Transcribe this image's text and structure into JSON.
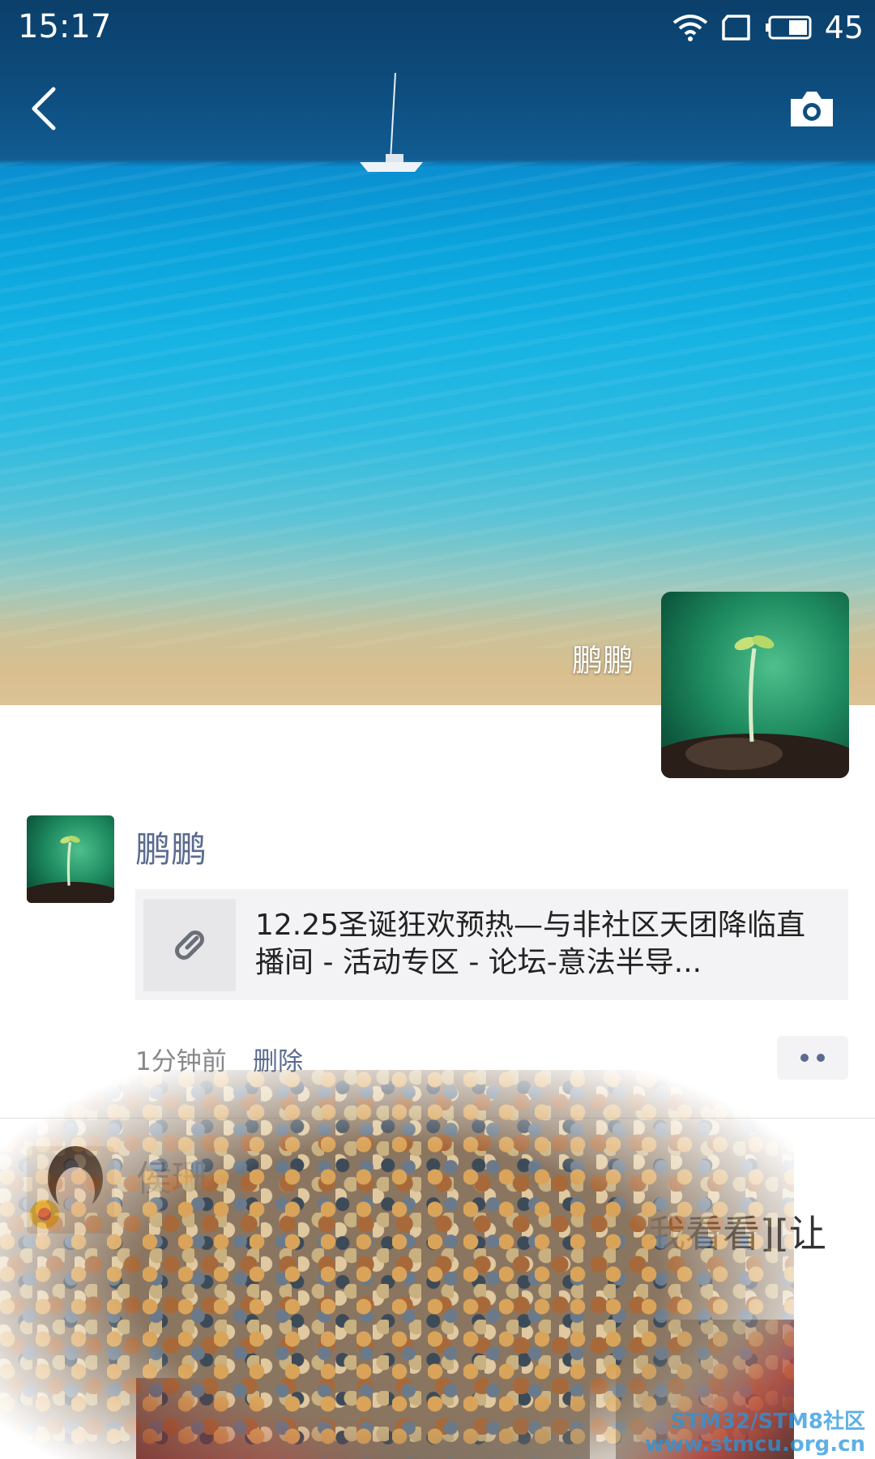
{
  "status_bar": {
    "time": "15:17",
    "battery_percent": "45",
    "icons": [
      "wifi-icon",
      "sim-card-icon",
      "battery-icon"
    ]
  },
  "header": {
    "back_icon": "back-arrow-icon",
    "camera_icon": "camera-icon"
  },
  "profile": {
    "name": "鹏鹏",
    "avatar_icon": "seedling-avatar"
  },
  "posts": [
    {
      "username": "鹏鹏",
      "link_icon": "link-icon",
      "link_title_line1": "12.25圣诞狂欢预热—与非社区天团降临直",
      "link_title_line2": "播间 - 活动专区 - 论坛-意法半导...",
      "time": "1分钟前",
      "delete_label": "删除",
      "more_icon": "more-dots-icon"
    },
    {
      "username": "侯珊",
      "text": "我看看][让"
    }
  ],
  "watermark": {
    "line1": "STM32/STM8社区",
    "line2": "www.stmcu.org.cn"
  },
  "colors": {
    "link_blue": "#5b6b8f",
    "card_bg": "#f3f3f5",
    "sea_blue": "#0aa3dc"
  }
}
